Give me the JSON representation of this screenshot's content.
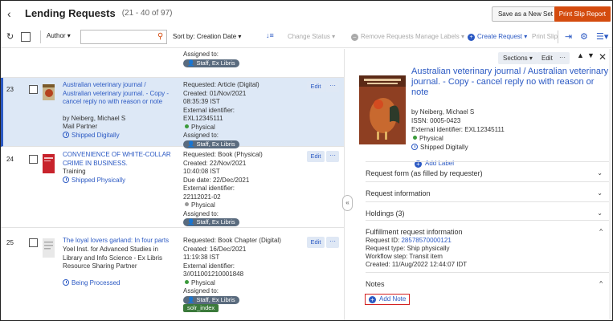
{
  "header": {
    "back": "‹",
    "title": "Lending Requests",
    "range": "(21 - 40 of 97)",
    "save_set": "Save as a New Set",
    "print_slip": "Print Slip Report"
  },
  "toolbar": {
    "facet": "Author",
    "search_placeholder": "",
    "sort_label": "Sort by:",
    "sort_value": "Creation Date",
    "change_status": "Change Status",
    "remove_requests": "Remove Requests",
    "manage_labels": "Manage Labels",
    "create_request": "Create Request",
    "print_slip": "Print Slip"
  },
  "list": {
    "partial_top": {
      "assigned_label": "Assigned to:",
      "assigned_value": "Staff, Ex Libris"
    },
    "rows": [
      {
        "num": "23",
        "title": "Australian veterinary journal / Australian veterinary journal. - Copy - cancel reply no with reason or note",
        "author": "by Neiberg, Michael S",
        "partner": "Mail Partner",
        "status": "Shipped Digitally",
        "requested_label": "Requested:",
        "requested_value": "Article (Digital)",
        "created_label": "Created:",
        "created_value": "01/Nov/2021",
        "created_time": "08:35:39 IST",
        "ext_label": "External identifier:",
        "ext_value": "EXL12345111",
        "format": "Physical",
        "assigned_label": "Assigned to:",
        "assigned_value": "Staff, Ex Libris",
        "edit": "Edit",
        "more": "···"
      },
      {
        "num": "24",
        "title": "CONVENIENCE OF WHITE-COLLAR CRIME IN BUSINESS.",
        "partner": "Training",
        "status": "Shipped Physically",
        "requested_label": "Requested:",
        "requested_value": "Book (Physical)",
        "created_label": "Created:",
        "created_value": "22/Nov/2021",
        "created_time": "10:40:08 IST",
        "due_label": "Due date:",
        "due_value": "22/Dec/2021",
        "ext_label": "External identifier:",
        "ext_value": "22112021-02",
        "format": "Physical",
        "assigned_label": "Assigned to:",
        "assigned_value": "Staff, Ex Libris",
        "edit": "Edit",
        "more": "···"
      },
      {
        "num": "25",
        "title": "The loyal lovers garland: In four parts",
        "partner": "Yoel Inst. for Advanced Studies in Library and Info Science - Ex Libris Resource Sharing Partner",
        "status": "Being Processed",
        "requested_label": "Requested:",
        "requested_value": "Book Chapter (Digital)",
        "created_label": "Created:",
        "created_value": "16/Dec/2021",
        "created_time": "11:19:38 IST",
        "ext_label": "External identifier:",
        "ext_value": "3//011001210001848",
        "format": "Physical",
        "assigned_label": "Assigned to:",
        "assigned_value": "Staff, Ex Libris",
        "tag": "solr_index",
        "edit": "Edit",
        "more": "···"
      }
    ]
  },
  "panel": {
    "sections": "Sections",
    "edit": "Edit",
    "more": "···",
    "title": "Australian veterinary journal / Australian veterinary journal. - Copy - cancel reply no with reason or note",
    "author": "by Neiberg, Michael S",
    "issn": "ISSN: 0005-0423",
    "ext_id": "External identifier: EXL12345111",
    "format": "Physical",
    "status": "Shipped Digitally",
    "add_label": "Add Label",
    "accordions": {
      "request_form": "Request form (as filled by requester)",
      "request_info": "Request information",
      "holdings": "Holdings (3)",
      "fulfillment": "Fulfillment request information",
      "notes": "Notes"
    },
    "fulfillment": {
      "request_id_label": "Request ID:",
      "request_id": "28578570000121",
      "type": "Request type: Ship physically",
      "workflow": "Workflow step: Transit item",
      "created": "Created: 11/Aug/2022 12:44:07 IDT"
    },
    "add_note": "Add Note"
  },
  "colors": {
    "accent": "#2b59c3",
    "print_button": "#d44b0e",
    "selected_row": "#dde8f6",
    "physical_dot": "#3b9a3b"
  }
}
